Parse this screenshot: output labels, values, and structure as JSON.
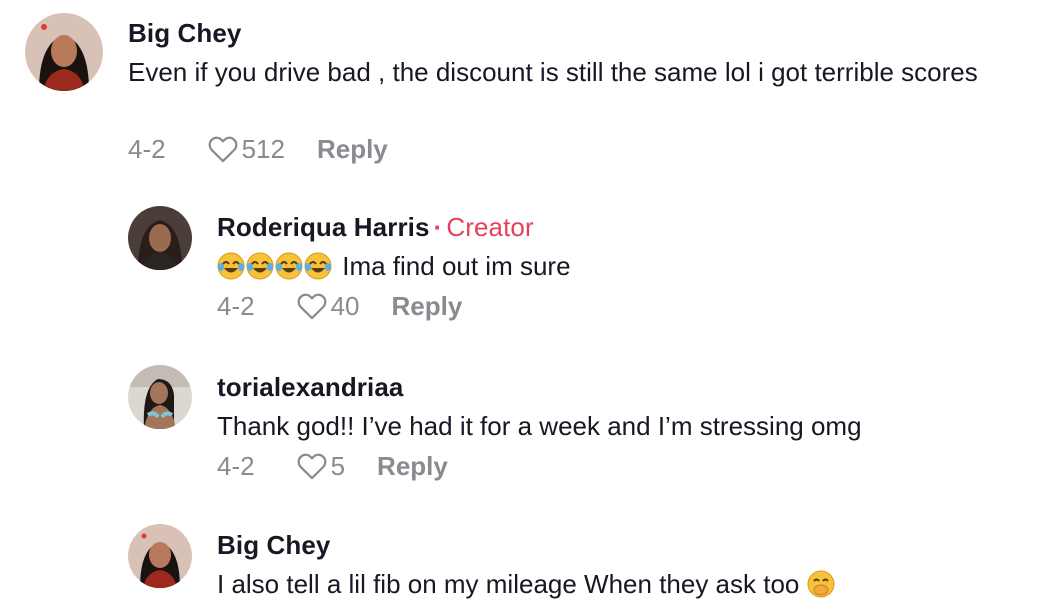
{
  "comments": [
    {
      "username": "Big Chey",
      "text": "Even if you drive bad , the discount is still the same lol i got terrible scores",
      "date": "4-2",
      "likes": "512",
      "reply_label": "Reply",
      "avatar_colors": {
        "bg": "#c9a89a",
        "hair": "#1a120e",
        "skin": "#b97a5c",
        "shirt": "#9a2a1c"
      }
    },
    {
      "username": "Roderiqua Harris",
      "creator_label": "Creator",
      "text": "Ima find out im sure",
      "emoji": "laughing-crying-emoji",
      "emoji_count": 4,
      "date": "4-2",
      "likes": "40",
      "reply_label": "Reply",
      "avatar_colors": {
        "bg": "#3b3230",
        "hair": "#2a1e18",
        "skin": "#9a6a52",
        "shirt": "#2c2622"
      }
    },
    {
      "username": "torialexandriaa",
      "text": "Thank god!! I’ve had it for a week and I’m stressing omg",
      "date": "4-2",
      "likes": "5",
      "reply_label": "Reply",
      "avatar_colors": {
        "bg": "#d9d5d0",
        "hair": "#1f1915",
        "skin": "#a5745b",
        "shirt": "#7ec3d6"
      }
    },
    {
      "username": "Big Chey",
      "text": "I also tell a lil fib on my mileage When they ask too",
      "emoji": "hand-over-mouth-emoji",
      "date": "",
      "likes": "",
      "reply_label": "",
      "avatar_colors": {
        "bg": "#c9a89a",
        "hair": "#1a120e",
        "skin": "#b97a5c",
        "shirt": "#9a2a1c"
      }
    }
  ],
  "colors": {
    "accent_creator": "#e5415d",
    "meta_gray": "#8a8b91",
    "text": "#161823"
  },
  "icons": {
    "like": "heart-outline-icon"
  }
}
